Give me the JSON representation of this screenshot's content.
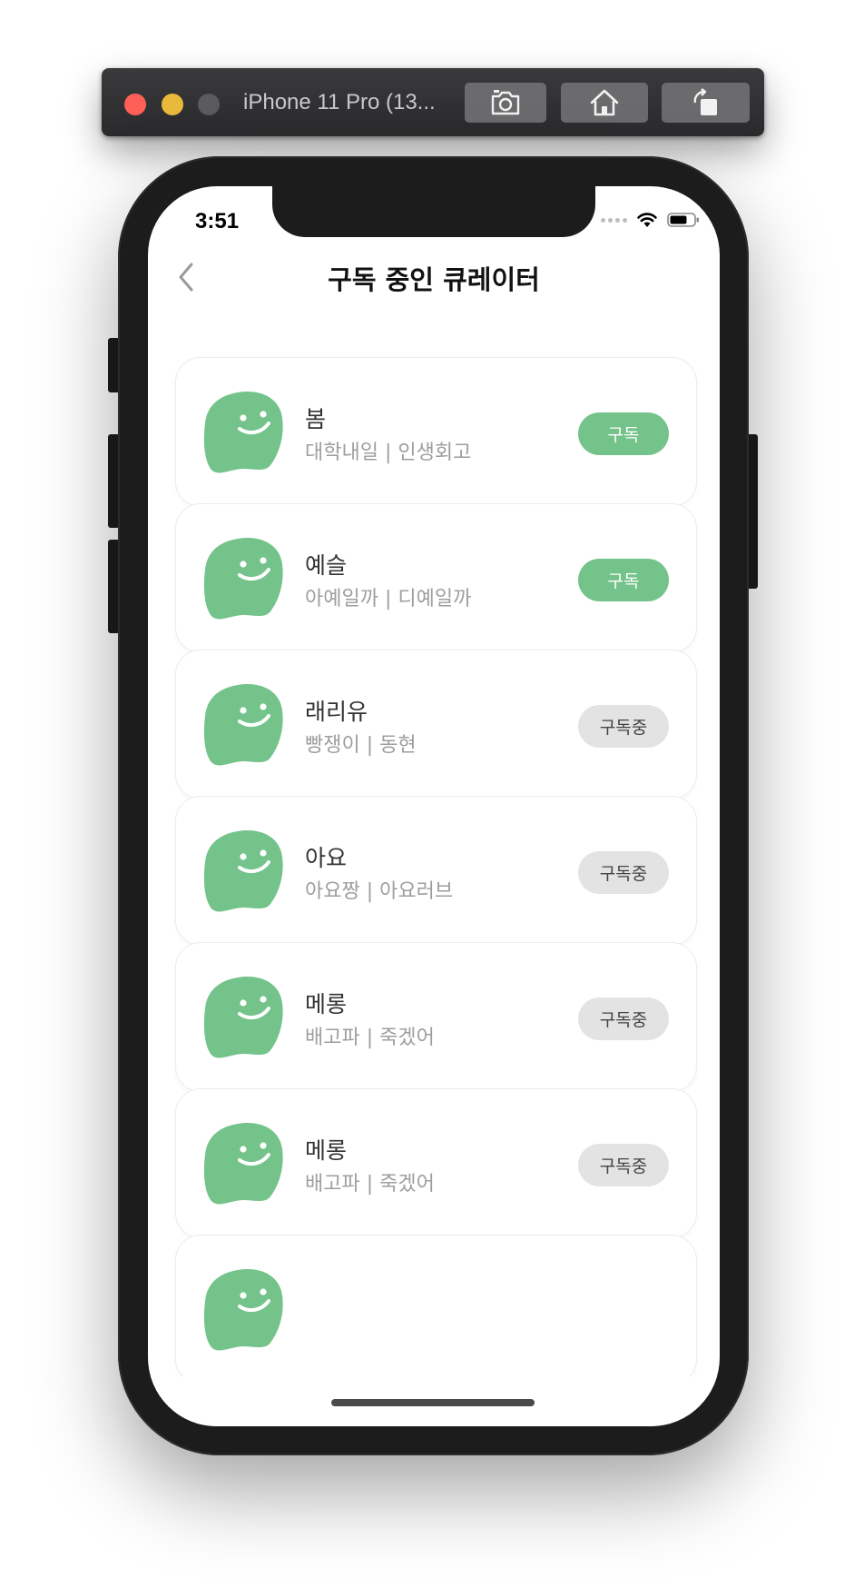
{
  "simulator": {
    "title": "iPhone 11 Pro (13...",
    "buttons": [
      {
        "name": "screenshot",
        "icon": "camera-icon"
      },
      {
        "name": "home",
        "icon": "home-icon"
      },
      {
        "name": "rotate",
        "icon": "rotate-icon"
      }
    ]
  },
  "status_bar": {
    "time": "3:51",
    "icons": [
      "signal-dots-icon",
      "wifi-icon",
      "battery-icon"
    ]
  },
  "header": {
    "title": "구독 중인 큐레이터",
    "back_icon": "chevron-left-icon"
  },
  "colors": {
    "accent_green": "#74c38a",
    "subscribed_gray": "#e3e3e3"
  },
  "curators": [
    {
      "name": "봄",
      "desc": "대학내일 | 인생회고",
      "button": "구독",
      "state": "subscribe"
    },
    {
      "name": "예슬",
      "desc": "아예일까 | 디예일까",
      "button": "구독",
      "state": "subscribe"
    },
    {
      "name": "래리유",
      "desc": "빵쟁이 | 동현",
      "button": "구독중",
      "state": "subscribed"
    },
    {
      "name": "아요",
      "desc": "아요짱 | 아요러브",
      "button": "구독중",
      "state": "subscribed"
    },
    {
      "name": "메롱",
      "desc": "배고파 | 죽겠어",
      "button": "구독중",
      "state": "subscribed"
    },
    {
      "name": "메롱",
      "desc": "배고파 | 죽겠어",
      "button": "구독중",
      "state": "subscribed"
    }
  ]
}
